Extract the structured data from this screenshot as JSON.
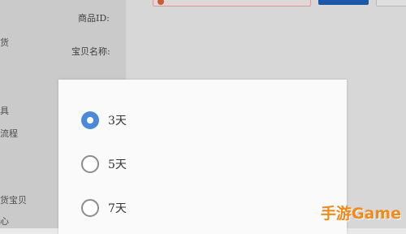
{
  "background": {
    "sidebar_items": [
      "货",
      "具",
      "流程",
      "货宝贝",
      "心"
    ],
    "form_labels": {
      "product_id": "商品ID:",
      "item_name": "宝贝名称:"
    }
  },
  "dialog": {
    "options": [
      {
        "label": "3天",
        "selected": true
      },
      {
        "label": "5天",
        "selected": false
      },
      {
        "label": "7天",
        "selected": false
      }
    ]
  },
  "watermark": "手游Game",
  "colors": {
    "radio_selected": "#4a8ad8",
    "primary_button": "#1f5fb8",
    "watermark": "#f08a1e"
  }
}
